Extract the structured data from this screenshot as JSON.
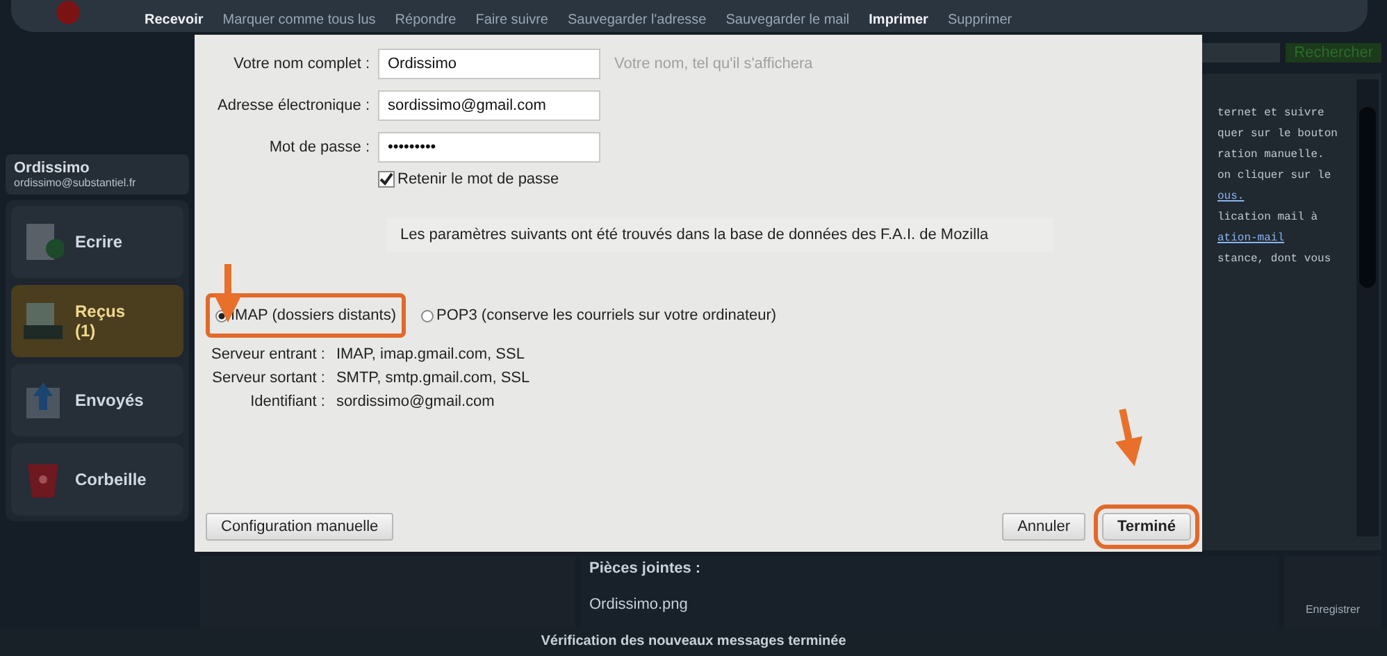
{
  "toolbar": {
    "items": [
      {
        "label": "Recevoir",
        "enabled": true
      },
      {
        "label": "Marquer comme tous lus",
        "enabled": false
      },
      {
        "label": "Répondre",
        "enabled": false
      },
      {
        "label": "Faire suivre",
        "enabled": false
      },
      {
        "label": "Sauvegarder l'adresse",
        "enabled": false
      },
      {
        "label": "Sauvegarder le mail",
        "enabled": false
      },
      {
        "label": "Imprimer",
        "enabled": true
      },
      {
        "label": "Supprimer",
        "enabled": false
      }
    ]
  },
  "account": {
    "name": "Ordissimo",
    "email": "ordissimo@substantiel.fr"
  },
  "sidebar": {
    "items": [
      {
        "label": "Ecrire",
        "kind": "write",
        "selected": false
      },
      {
        "label": "Reçus\n(1)",
        "kind": "inbox",
        "selected": true
      },
      {
        "label": "Envoyés",
        "kind": "sent",
        "selected": false
      },
      {
        "label": "Corbeille",
        "kind": "trash",
        "selected": false
      }
    ]
  },
  "search_button": "Rechercher",
  "message_lines": [
    {
      "text": "ternet et suivre",
      "link": false
    },
    {
      "text": "quer sur le bouton",
      "link": false
    },
    {
      "text": "ration manuelle.",
      "link": false
    },
    {
      "text": "on cliquer sur le",
      "link": false
    },
    {
      "text": "ous.",
      "link": true
    },
    {
      "text": "lication mail à",
      "link": false
    },
    {
      "text": "ation-mail",
      "link": true
    },
    {
      "text": "stance, dont vous",
      "link": false
    }
  ],
  "attachments": {
    "title": "Pièces jointes :",
    "files": [
      "Ordissimo.png"
    ],
    "save_button": "Enregistrer"
  },
  "status_bar": "Vérification des nouveaux messages terminée",
  "dialog": {
    "fields": [
      {
        "label": "Votre nom complet :",
        "value": "Ordissimo",
        "hint": "Votre nom, tel qu'il s'affichera"
      },
      {
        "label": "Adresse électronique :",
        "value": "sordissimo@gmail.com"
      },
      {
        "label": "Mot de passe :",
        "value": "•••••••••"
      }
    ],
    "remember_password": {
      "label": "Retenir le mot de passe",
      "checked": true
    },
    "info": "Les paramètres suivants ont été trouvés dans la base de données des F.A.I. de Mozilla",
    "protocols": [
      {
        "label": "IMAP (dossiers distants)",
        "selected": true,
        "highlighted": true
      },
      {
        "label": "POP3 (conserve les courriels sur votre ordinateur)",
        "selected": false,
        "highlighted": false
      }
    ],
    "servers": [
      {
        "label": "Serveur entrant :",
        "value": "IMAP, imap.gmail.com, SSL"
      },
      {
        "label": "Serveur sortant :",
        "value": "SMTP, smtp.gmail.com, SSL"
      },
      {
        "label": "Identifiant :",
        "value": "sordissimo@gmail.com"
      }
    ],
    "buttons": [
      {
        "label": "Configuration manuelle",
        "kind": "left",
        "highlighted": false,
        "bold": false
      },
      {
        "label": "Annuler",
        "kind": "right",
        "highlighted": false,
        "bold": false
      },
      {
        "label": "Terminé",
        "kind": "right",
        "highlighted": true,
        "bold": true
      }
    ]
  }
}
